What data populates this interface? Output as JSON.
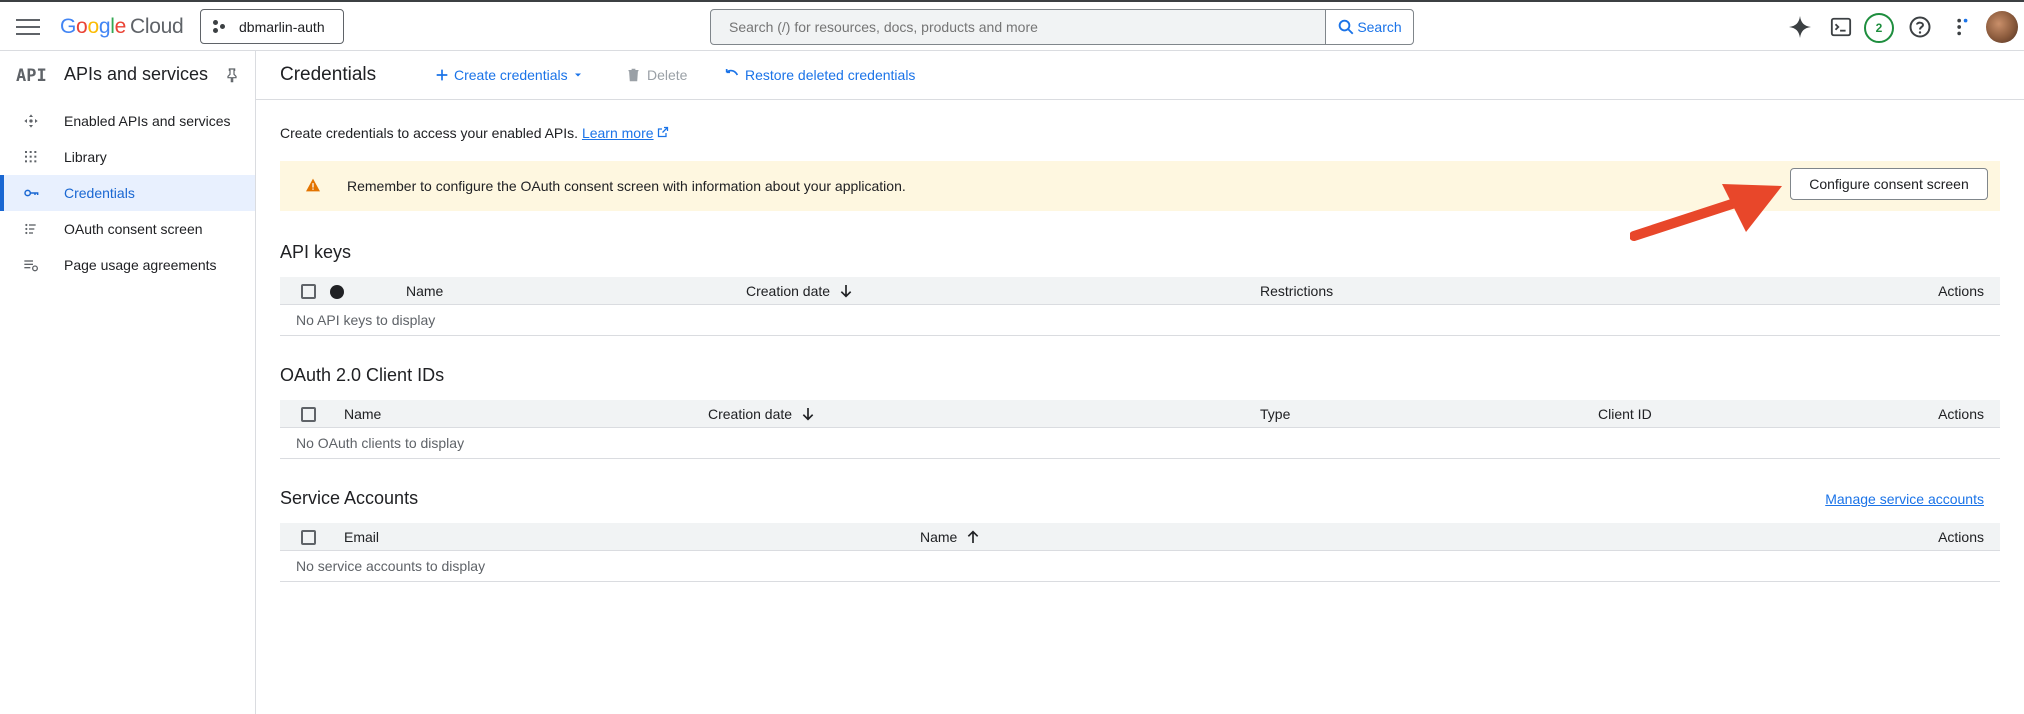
{
  "header": {
    "brand": {
      "g": "G",
      "o1": "o",
      "o2": "o",
      "g2": "g",
      "l": "l",
      "e": "e",
      "cloud": "Cloud"
    },
    "project": "dbmarlin-auth",
    "search_placeholder": "Search (/) for resources, docs, products and more",
    "search_button": "Search",
    "notifications_count": "2",
    "icons": [
      "menu-icon",
      "gemini-sparkle-icon",
      "cloud-shell-icon",
      "help-icon",
      "more-vert-icon"
    ]
  },
  "sidebar": {
    "logo": "API",
    "title": "APIs and services",
    "items": [
      {
        "label": "Enabled APIs and services",
        "icon": "enabled-apis-icon"
      },
      {
        "label": "Library",
        "icon": "library-icon"
      },
      {
        "label": "Credentials",
        "icon": "key-icon",
        "active": true
      },
      {
        "label": "OAuth consent screen",
        "icon": "oauth-consent-icon"
      },
      {
        "label": "Page usage agreements",
        "icon": "page-usage-icon"
      }
    ]
  },
  "actionbar": {
    "title": "Credentials",
    "create": "Create credentials",
    "delete": "Delete",
    "restore": "Restore deleted credentials"
  },
  "main": {
    "intro": "Create credentials to access your enabled APIs.",
    "learn_more": "Learn more",
    "banner_msg": "Remember to configure the OAuth consent screen with information about your application.",
    "configure_button": "Configure consent screen",
    "api_keys": {
      "title": "API keys",
      "columns": [
        "Name",
        "Creation date",
        "Restrictions",
        "Actions"
      ],
      "empty": "No API keys to display"
    },
    "oauth": {
      "title": "OAuth 2.0 Client IDs",
      "columns": [
        "Name",
        "Creation date",
        "Type",
        "Client ID",
        "Actions"
      ],
      "empty": "No OAuth clients to display"
    },
    "service_accounts": {
      "title": "Service Accounts",
      "manage": "Manage service accounts",
      "columns": [
        "Email",
        "Name",
        "Actions"
      ],
      "empty": "No service accounts to display"
    }
  },
  "colors": {
    "accent": "#1a73e8",
    "warning": "#e37400",
    "banner": "#fef7e0",
    "annotation_arrow": "#e8472a"
  }
}
